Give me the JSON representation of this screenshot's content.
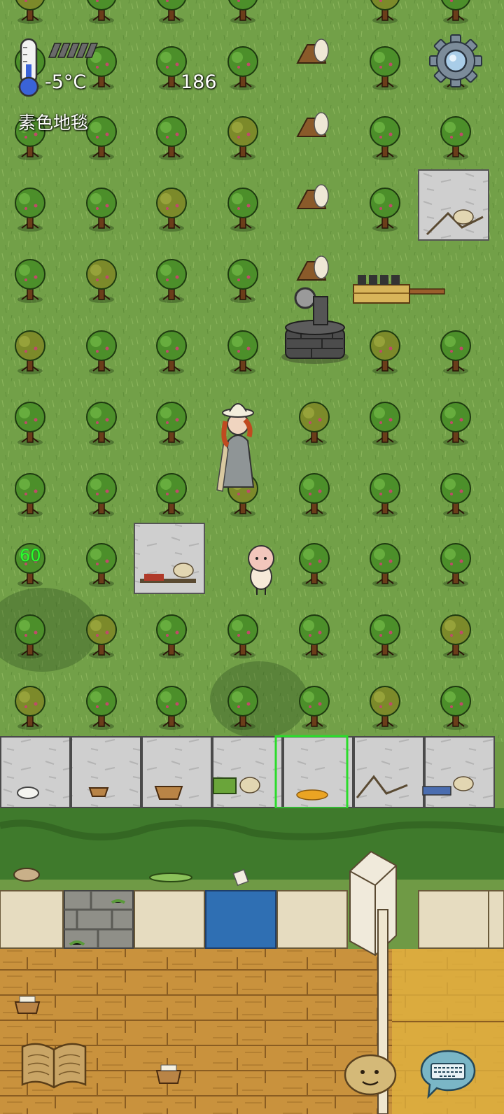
{
  "hud": {
    "temperature": "-5°C",
    "food_count": "186",
    "ground_label": "素色地毯",
    "age_value": "60",
    "food_bar_segments": 5,
    "food_bar_filled": 0
  },
  "icons": {
    "thermometer": "thermometer-icon",
    "settings": "gear-icon",
    "tech_book": "open-book-icon",
    "emote": "emote-face-icon",
    "chat": "keyboard-chat-icon"
  },
  "colors": {
    "grass": "#6f9a45",
    "hedge": "#3f7a2c",
    "stone_floor": "#c9c9c9",
    "wood_floor": "#c8923c",
    "selection": "#2bdc2b",
    "temperature_blue": "#3a63d8",
    "water": "#2f6fb3"
  }
}
